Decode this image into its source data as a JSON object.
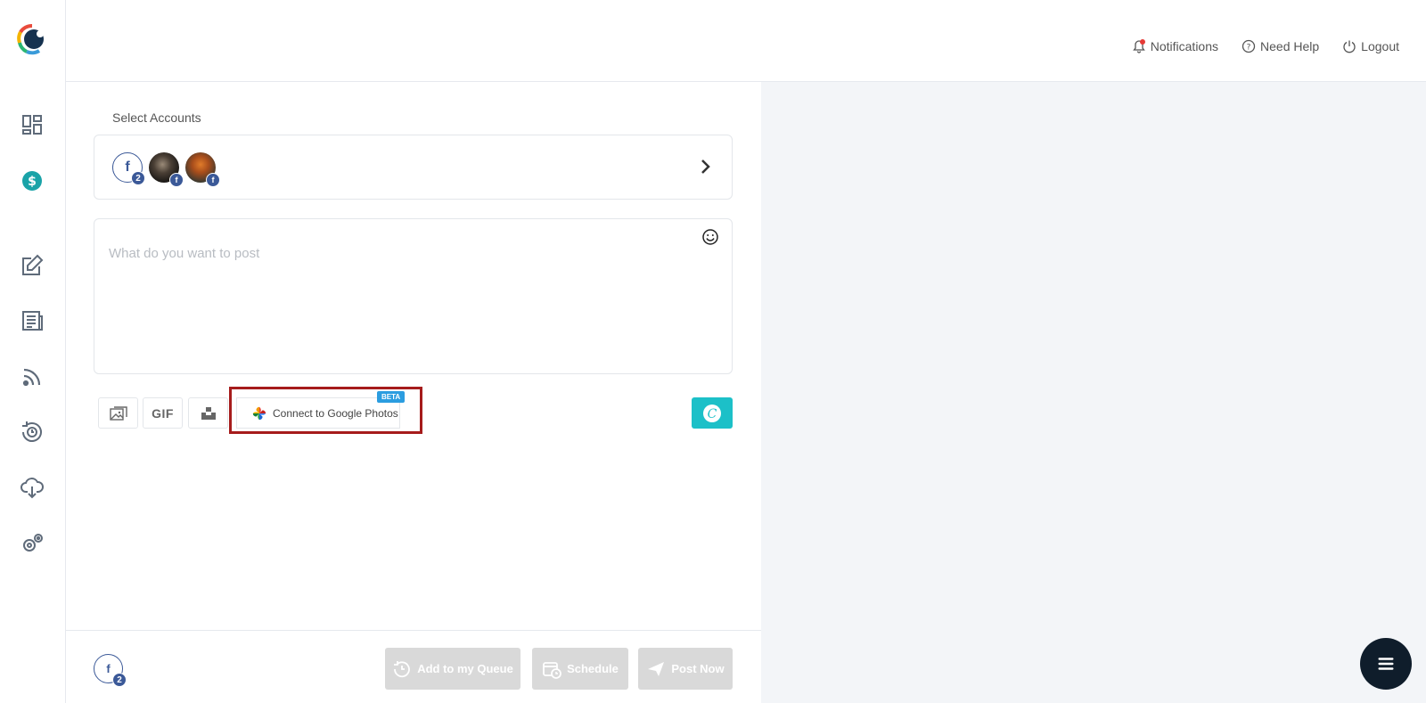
{
  "header": {
    "notifications_label": "Notifications",
    "help_label": "Need Help",
    "logout_label": "Logout"
  },
  "sidebar": {
    "items": [
      {
        "icon": "dashboard-icon"
      },
      {
        "icon": "dollar-icon"
      },
      {
        "icon": "compose-icon"
      },
      {
        "icon": "articles-icon"
      },
      {
        "icon": "rss-icon"
      },
      {
        "icon": "schedule-refresh-icon"
      },
      {
        "icon": "cloud-download-icon"
      },
      {
        "icon": "settings-icon"
      }
    ]
  },
  "composer": {
    "select_accounts_label": "Select Accounts",
    "fb_group_count": "2",
    "post_placeholder": "What do you want to post",
    "gif_label": "GIF",
    "google_photos_label": "Connect to Google Photos",
    "beta_label": "BETA"
  },
  "footer": {
    "account_count": "2",
    "queue_label": "Add to my Queue",
    "schedule_label": "Schedule",
    "post_now_label": "Post Now"
  },
  "colors": {
    "facebook": "#3b5998",
    "canva": "#1cc0c8",
    "highlight": "#a61c1c",
    "beta": "#2b9de0",
    "fab": "#0f1d2b"
  }
}
